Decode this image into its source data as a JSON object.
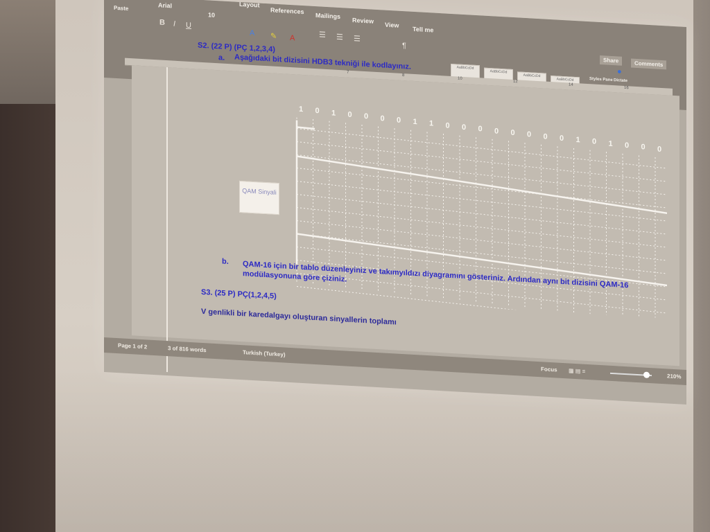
{
  "ribbon": {
    "tabs": [
      "Layout",
      "References",
      "Mailings",
      "Review",
      "View"
    ],
    "tell_me": "Tell me",
    "paste_label": "Paste",
    "font_name": "Arial",
    "font_size": "10",
    "styles": [
      "AaBbCcDd",
      "AaBbCcDd",
      "AaBbCcDd",
      "AaBbCcDd"
    ],
    "share_label": "Share",
    "comments_label": "Comments",
    "styles_pane_label": "Styles Pane",
    "dictate_label": "Dictate"
  },
  "document": {
    "q2_heading": "S2. (22 P) (PÇ 1,2,3,4)",
    "q2a_label": "a.",
    "q2a_text": "Aşağıdaki bit dizisini HDB3 tekniği ile kodlayınız.",
    "bits": [
      "1",
      "0",
      "1",
      "0",
      "0",
      "0",
      "0",
      "1",
      "1",
      "0",
      "0",
      "0",
      "0",
      "0",
      "0",
      "0",
      "0",
      "1",
      "0",
      "1",
      "0",
      "0",
      "0"
    ],
    "qam_box_text": "QAM Sinyali",
    "q2b_label": "b.",
    "q2b_line1": "QAM-16 için bir tablo düzenleyiniz ve takımyıldızı diyagramını gösteriniz. Ardından aynı bit dizisini QAM-16",
    "q2b_line2": "modülasyonuna göre çiziniz.",
    "q3_heading": "S3. (25 P) PÇ(1,2,4,5)",
    "q3_text": "V genlikli bir karedalgayı oluşturan sinyallerin toplamı"
  },
  "statusbar": {
    "page": "Page 1 of 2",
    "words": "3 of 816 words",
    "language": "Turkish (Turkey)",
    "focus": "Focus",
    "zoom": "210%"
  }
}
